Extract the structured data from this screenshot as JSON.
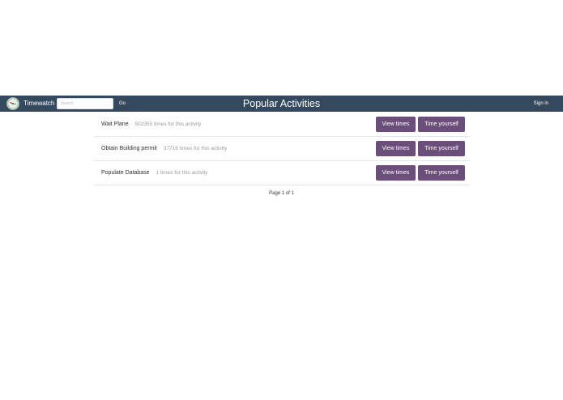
{
  "navbar": {
    "brand_name": "Timewatch",
    "logo_icon": "clock-logo-icon",
    "search_placeholder": "Search",
    "go_label": "Go",
    "title": "Popular Activities",
    "sign_in_label": "Sign in",
    "background_color": "#34495e"
  },
  "activities": [
    {
      "name": "Wait Plane",
      "count_text": "502355 times for this activity",
      "view_label": "View times",
      "time_label": "Time yourself"
    },
    {
      "name": "Obtain Building permit",
      "count_text": "37716 times for this activity",
      "view_label": "View times",
      "time_label": "Time yourself"
    },
    {
      "name": "Populate Database",
      "count_text": "1 times for this activity",
      "view_label": "View times",
      "time_label": "Time yourself"
    }
  ],
  "pagination": {
    "text": "Page 1 of 1"
  },
  "colors": {
    "button": "#6b4f7a",
    "navbar": "#34495e"
  }
}
